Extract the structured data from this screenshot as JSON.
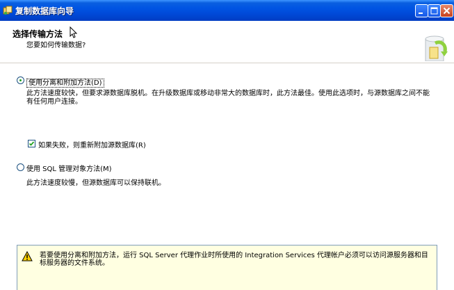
{
  "window": {
    "title": "复制数据库向导"
  },
  "header": {
    "title": "选择传输方法",
    "subtitle": "您要如何传输数据?"
  },
  "options": {
    "detach_attach": {
      "label": "使用分离和附加方法(D)",
      "selected": true,
      "description": "此方法速度较快，但要求源数据库脱机。在升级数据库或移动非常大的数据库时，此方法最佳。使用此选项时，与源数据库之间不能有任何用户连接。",
      "reattach_checkbox": {
        "label": "如果失败，则重新附加源数据库(R)",
        "checked": true
      }
    },
    "smo": {
      "label": "使用 SQL 管理对象方法(M)",
      "selected": false,
      "description": "此方法速度较慢，但源数据库可以保持联机。"
    }
  },
  "warning": {
    "text": "若要使用分离和附加方法，运行 SQL Server 代理作业时所使用的 Integration Services 代理帐户必须可以访问源服务器和目标服务器的文件系统。"
  },
  "colors": {
    "titlebar": "#0054e3",
    "warning_bg": "#ffffe1",
    "radio_dot": "#21a121"
  }
}
